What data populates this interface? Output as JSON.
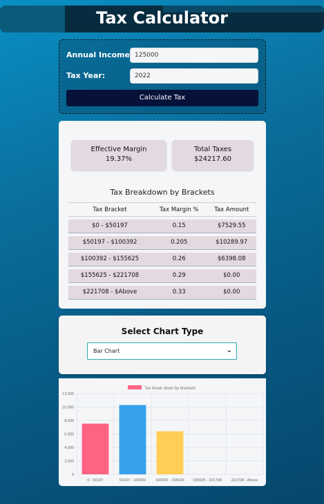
{
  "header": {
    "title": "Tax Calculator"
  },
  "form": {
    "income_label": "Annual Income:",
    "income_value": "125000",
    "year_label": "Tax Year:",
    "year_value": "2022",
    "calculate_label": "Calculate Tax"
  },
  "summary": {
    "margin_title": "Effective Margin",
    "margin_value": "19.37%",
    "taxes_title": "Total Taxes",
    "taxes_value": "$24217.60"
  },
  "breakdown": {
    "title": "Tax Breakdown by Brackets",
    "columns": [
      "Tax Bracket",
      "Tax Margin %",
      "Tax Amount"
    ],
    "rows": [
      [
        "$0 - $50197",
        "0.15",
        "$7529.55"
      ],
      [
        "$50197 - $100392",
        "0.205",
        "$10289.97"
      ],
      [
        "$100392 - $155625",
        "0.26",
        "$6398.08"
      ],
      [
        "$155625 - $221708",
        "0.29",
        "$0.00"
      ],
      [
        "$221708 - $Above",
        "0.33",
        "$0.00"
      ]
    ]
  },
  "chart_selector": {
    "title": "Select Chart Type",
    "selected": "Bar Chart"
  },
  "colors": {
    "series": [
      "#ff6384",
      "#36a2eb",
      "#ffce56",
      "#4bc0c0",
      "#9966ff"
    ]
  },
  "chart_data": {
    "type": "bar",
    "categories": [
      "0 - 50197",
      "50197 - 100392",
      "100392 - 155625",
      "155625 - 221708",
      "221708 - Above"
    ],
    "values": [
      7529.55,
      10289.97,
      6398.08,
      0,
      0
    ],
    "legend": "Tax break down by brackets",
    "ylim": [
      0,
      12000
    ],
    "yticks": [
      "0",
      "2,000",
      "4,000",
      "6,000",
      "8,000",
      "10,000",
      "12,000"
    ],
    "grid": true,
    "legend_position": "top"
  }
}
